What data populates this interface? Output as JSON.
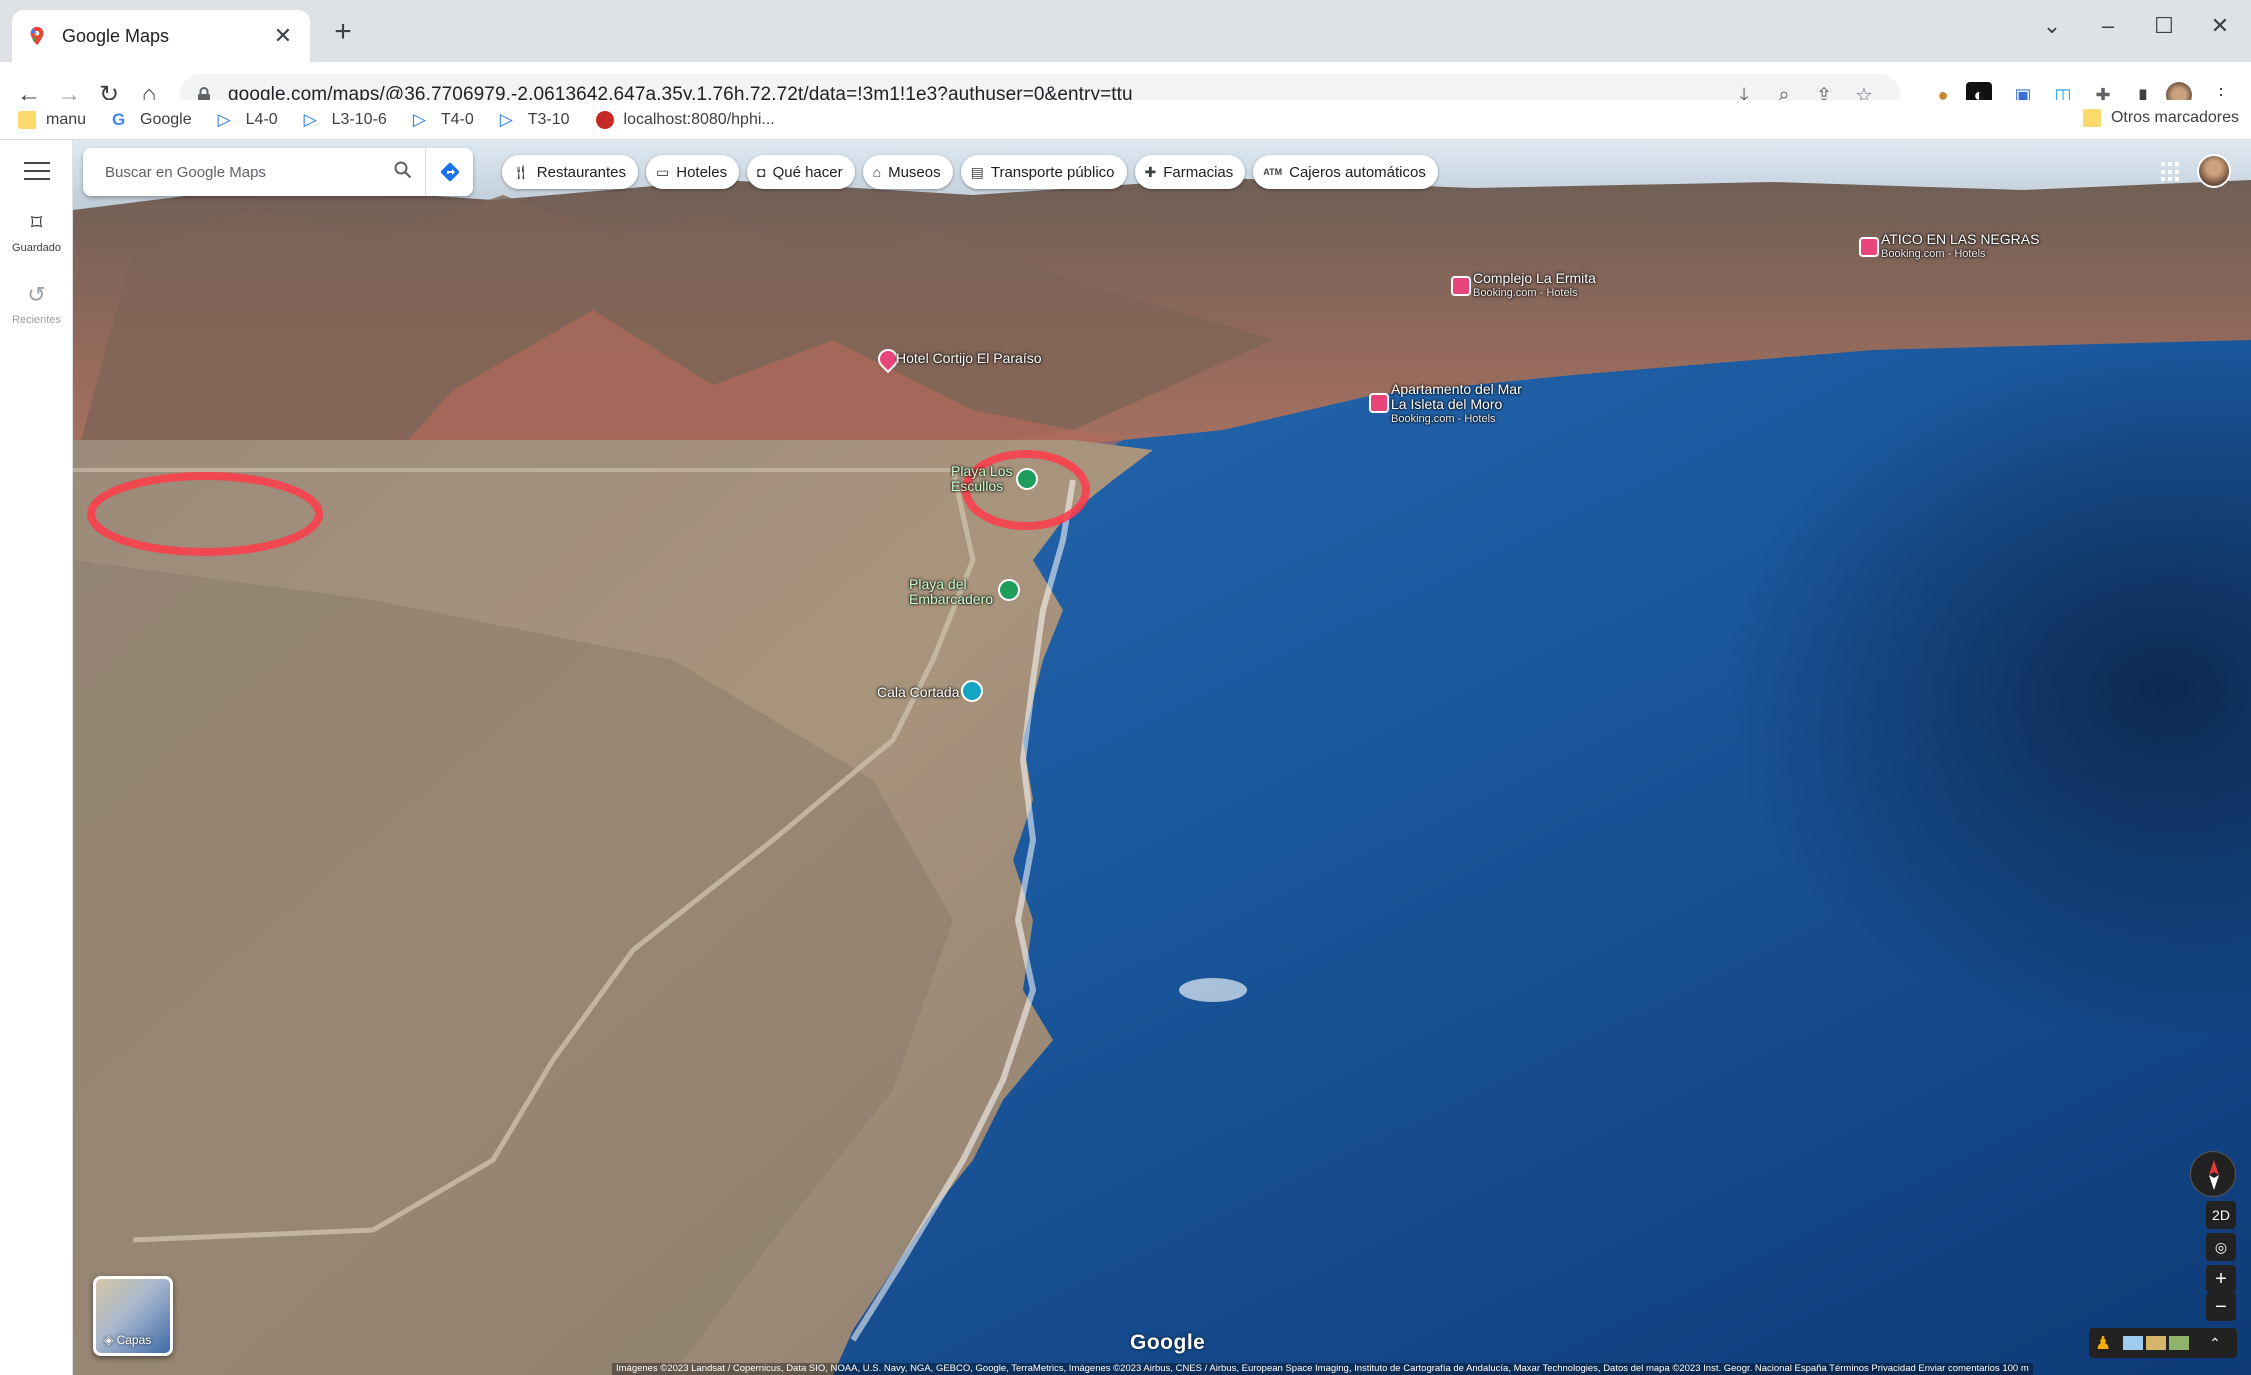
{
  "browser": {
    "tab_title": "Google Maps",
    "url": "google.com/maps/@36.7706979,-2.0613642,647a,35y,1.76h,72.72t/data=!3m1!1e3?authuser=0&entry=ttu",
    "bookmarks": [
      "manu",
      "Google",
      "L4-0",
      "L3-10-6",
      "T4-0",
      "T3-10",
      "localhost:8080/hphi..."
    ],
    "other_bookmarks": "Otros marcadores"
  },
  "rail": {
    "saved": "Guardado",
    "recent": "Recientes"
  },
  "search": {
    "placeholder": "Buscar en Google Maps"
  },
  "chips": [
    "Restaurantes",
    "Hoteles",
    "Qué hacer",
    "Museos",
    "Transporte público",
    "Farmacias",
    "Cajeros automáticos"
  ],
  "places": {
    "atico": {
      "name": "ATICO EN LAS NEGRAS",
      "sub": "Booking.com - Hotels"
    },
    "ermita": {
      "name": "Complejo La Ermita",
      "sub": "Booking.com - Hotels"
    },
    "cortijo": {
      "name": "Hotel Cortijo El Paraíso"
    },
    "apartamento": {
      "name1": "Apartamento del Mar",
      "name2": "La Isleta del Moro",
      "sub": "Booking.com - Hotels"
    },
    "escullos": {
      "name1": "Playa Los",
      "name2": "Escullos"
    },
    "embarcadero": {
      "name1": "Playa del",
      "name2": "Embarcadero"
    },
    "cortada": {
      "name": "Cala Cortada"
    }
  },
  "map": {
    "layers_label": "Capas",
    "logo": "Google",
    "attribution": "Imágenes ©2023 Landsat / Copernicus, Data SIO, NOAA, U.S. Navy, NGA, GEBCO, Google, TerraMetrics, Imágenes ©2023 Airbus, CNES / Airbus, European Space Imaging, Instituto de Cartografía de Andalucía, Maxar Technologies, Datos del mapa ©2023 Inst. Geogr. Nacional    España    Términos    Privacidad    Enviar comentarios    100 m",
    "view_toggle": "2D"
  },
  "colors": {
    "sea": "#1b4f8f",
    "land": "#a48d78",
    "highlight": "#ff3b4a",
    "hotel_pin": "#e8467b",
    "beach_pin": "#1e9e5a"
  }
}
